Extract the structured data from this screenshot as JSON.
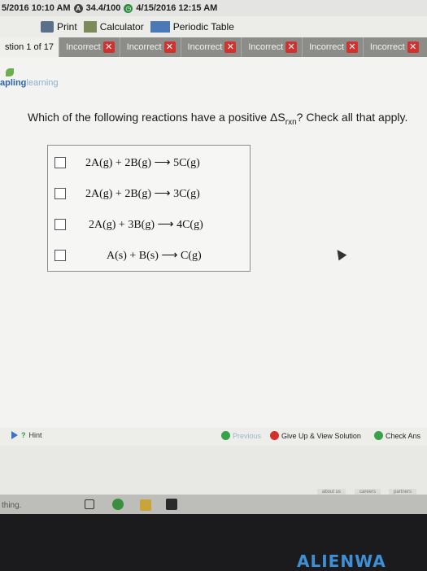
{
  "status": {
    "date_time": "5/2016 10:10 AM",
    "score": "34.4/100",
    "due": "4/15/2016 12:15 AM"
  },
  "toolbar": {
    "print": "Print",
    "calculator": "Calculator",
    "periodic_table": "Periodic Table"
  },
  "question_nav": {
    "current": "stion 1 of 17",
    "tabs": [
      "Incorrect",
      "Incorrect",
      "Incorrect",
      "Incorrect",
      "Incorrect",
      "Incorrect"
    ]
  },
  "logo": {
    "part1": "apling",
    "part2": "learning"
  },
  "question": {
    "text_before": "Which of the following reactions have a positive ΔS",
    "subscript": "rxn",
    "text_after": "? Check all that apply."
  },
  "choices": [
    {
      "reaction": "2A(g) + 2B(g) ⟶ 5C(g)",
      "checked": false
    },
    {
      "reaction": "2A(g) + 2B(g) ⟶ 3C(g)",
      "checked": false
    },
    {
      "reaction": "2A(g) + 3B(g) ⟶ 4C(g)",
      "checked": false
    },
    {
      "reaction": "A(s) + B(s) ⟶ C(g)",
      "checked": false
    }
  ],
  "bottom": {
    "hint": "Hint",
    "previous": "Previous",
    "give_up": "Give Up & View Solution",
    "check_answer": "Check Ans"
  },
  "footer_links": [
    "about us",
    "careers",
    "partners"
  ],
  "taskbar": {
    "search_text": "thing."
  },
  "bezel": {
    "brand": "ALIENWA"
  },
  "colors": {
    "incorrect": "#d2322d",
    "tab_bar": "#8c8c88",
    "link_blue": "#2d64a6",
    "ok_green": "#38a14a"
  }
}
